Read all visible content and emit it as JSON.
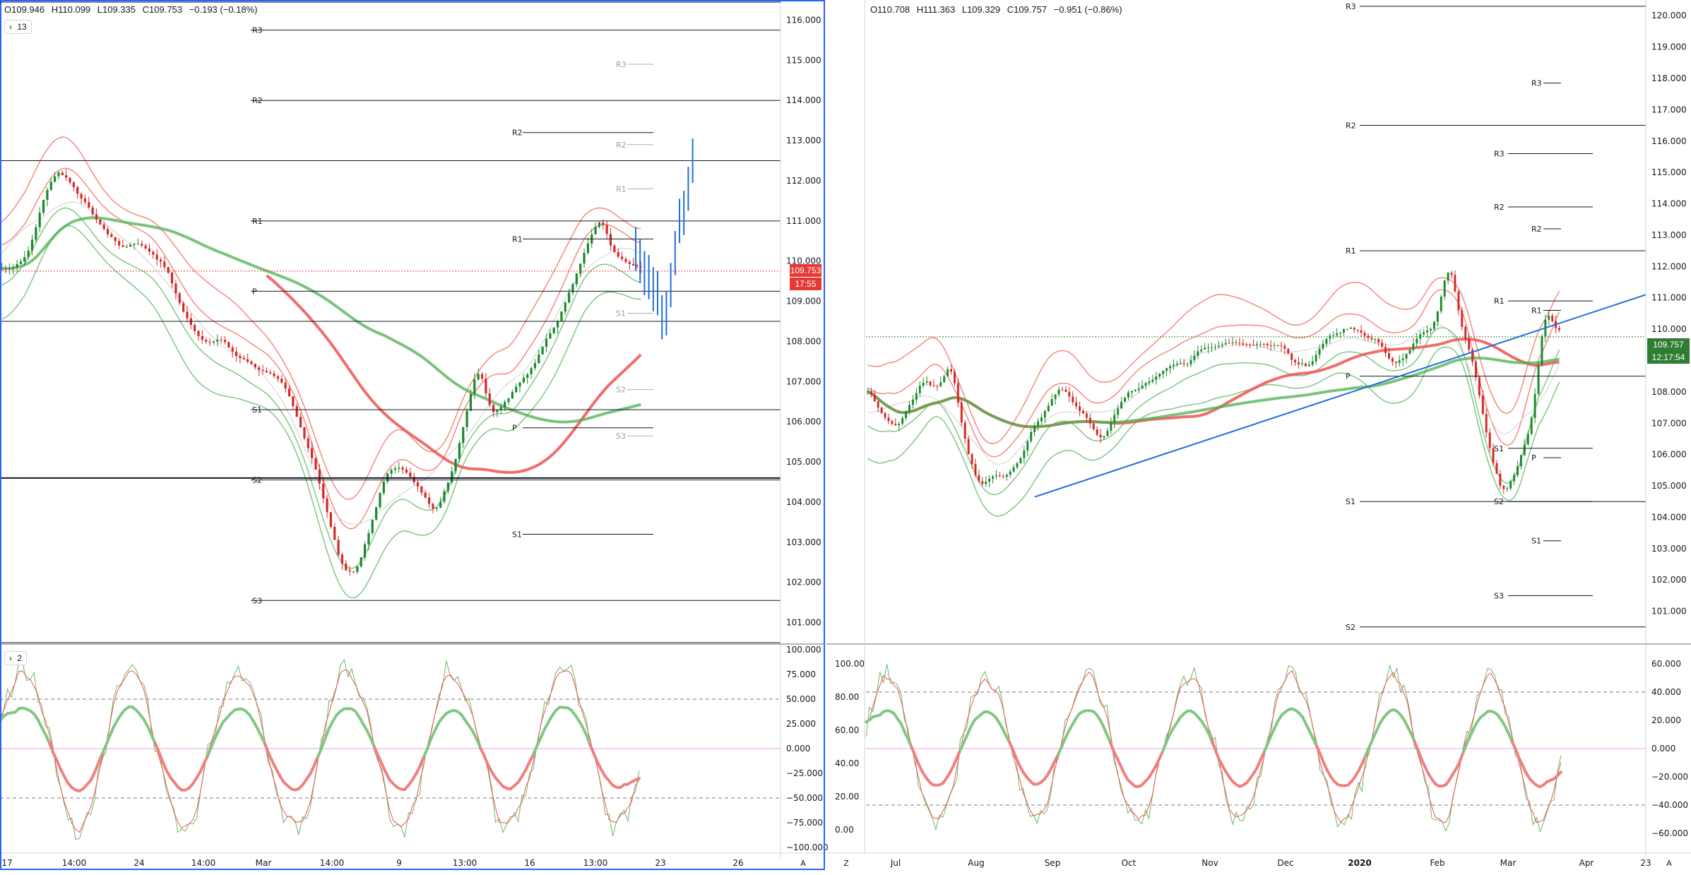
{
  "colors": {
    "accent": "#2962ff",
    "bull": "#26a69a",
    "bear": "#ef5350",
    "sma_red": "#ef5350",
    "sma_green": "#4caf50",
    "band_red": "#f28b82",
    "band_green": "#81c784",
    "grey_band": "#cfcfcf",
    "projection": "#1e6fd9",
    "price_label": "#e53935",
    "price_label_right": "#2e7d32"
  },
  "left_chart": {
    "ohlc": {
      "o": "O109.946",
      "h": "H110.099",
      "l": "L109.335",
      "c": "C109.753",
      "chg": "−0.193 (−0.18%)"
    },
    "legend_toggle": "13",
    "osc_toggle": "2",
    "price_badge": "109.753",
    "countdown_badge": "17:55",
    "pivots_major": [
      {
        "label": "R3",
        "value": 115.75
      },
      {
        "label": "R2",
        "value": 114.0
      },
      {
        "label": "R1",
        "value": 111.0
      },
      {
        "label": "P",
        "value": 109.25
      },
      {
        "label": "S1",
        "value": 106.3
      },
      {
        "label": "S2",
        "value": 104.55
      },
      {
        "label": "S3",
        "value": 101.55
      }
    ],
    "pivots_minor": [
      {
        "label": "R2",
        "value": 113.2
      },
      {
        "label": "R1",
        "value": 110.55
      },
      {
        "label": "P",
        "value": 105.85
      },
      {
        "label": "S1",
        "value": 103.2
      }
    ],
    "pivots_grey": [
      {
        "label": "R3",
        "value": 114.9
      },
      {
        "label": "R2",
        "value": 112.9
      },
      {
        "label": "R1",
        "value": 111.8
      },
      {
        "label": "S1",
        "value": 108.7
      },
      {
        "label": "S2",
        "value": 106.8
      },
      {
        "label": "S3",
        "value": 105.65
      }
    ],
    "extra_lines": [
      112.5,
      108.5,
      104.6,
      100.5
    ],
    "y_axis_ticks": [
      "116.000",
      "115.000",
      "114.000",
      "113.000",
      "112.000",
      "111.000",
      "110.000",
      "109.000",
      "108.000",
      "107.000",
      "106.000",
      "105.000",
      "104.000",
      "103.000",
      "102.000",
      "101.000"
    ],
    "osc_axis_ticks": [
      "100.000",
      "75.000",
      "50.000",
      "25.000",
      "0.000",
      "−25.000",
      "−50.000",
      "−75.000",
      "−100.000"
    ],
    "x_axis_labels": [
      "17",
      "14:00",
      "24",
      "14:00",
      "Mar",
      "14:00",
      "9",
      "13:00",
      "16",
      "13:00",
      "23",
      "26"
    ],
    "axis_corner": "A"
  },
  "right_chart": {
    "ohlc": {
      "o": "O110.708",
      "h": "H111.363",
      "l": "L109.329",
      "c": "C109.757",
      "chg": "−0.951 (−0.86%)"
    },
    "price_badge": "109.757",
    "countdown_badge": "12:17:54",
    "pivots_major": [
      {
        "label": "R3",
        "value": 120.3
      },
      {
        "label": "R2",
        "value": 116.5
      },
      {
        "label": "R1",
        "value": 112.5
      },
      {
        "label": "P",
        "value": 108.5
      },
      {
        "label": "S1",
        "value": 104.5
      },
      {
        "label": "S2",
        "value": 100.5
      }
    ],
    "pivots_mid": [
      {
        "label": "R3",
        "value": 115.6
      },
      {
        "label": "R2",
        "value": 113.9
      },
      {
        "label": "R1",
        "value": 110.9
      },
      {
        "label": "S1",
        "value": 106.2
      },
      {
        "label": "S2",
        "value": 104.5
      },
      {
        "label": "S3",
        "value": 101.5
      }
    ],
    "pivots_small": [
      {
        "label": "R3",
        "value": 117.85
      },
      {
        "label": "R2",
        "value": 113.2
      },
      {
        "label": "R1",
        "value": 110.6
      },
      {
        "label": "P",
        "value": 105.9
      },
      {
        "label": "S1",
        "value": 103.25
      }
    ],
    "y_axis_ticks": [
      "120.000",
      "119.000",
      "118.000",
      "117.000",
      "116.000",
      "115.000",
      "114.000",
      "113.000",
      "112.000",
      "111.000",
      "110.000",
      "109.000",
      "108.000",
      "107.000",
      "106.000",
      "105.000",
      "104.000",
      "103.000",
      "102.000",
      "101.000"
    ],
    "osc_left_ticks": [
      "100.00",
      "80.00",
      "60.00",
      "40.00",
      "20.00",
      "0.00"
    ],
    "osc_right_ticks": [
      "60.000",
      "40.000",
      "20.000",
      "0.000",
      "−20.000",
      "−40.000",
      "−60.000"
    ],
    "x_axis_labels": [
      "Jul",
      "Aug",
      "Sep",
      "Oct",
      "Nov",
      "Dec",
      "2020",
      "Feb",
      "Mar",
      "Apr",
      "23"
    ],
    "axis_corner_left": "Z",
    "axis_corner_right": "A"
  },
  "chart_data": [
    {
      "type": "line",
      "series": [
        {
          "values": [
            109.8,
            109.9,
            110.2,
            111.5,
            112.3,
            112.0,
            111.5,
            111.0,
            110.6,
            110.3,
            110.5,
            110.2,
            109.9,
            109.0,
            108.3,
            108.0,
            108.1,
            107.7,
            107.5,
            107.3,
            107.2,
            106.7,
            105.8,
            105.0,
            103.6,
            102.4,
            102.2,
            103.2,
            104.5,
            105.0,
            104.6,
            104.2,
            103.8,
            104.6,
            106.0,
            107.5,
            106.2,
            106.5,
            107.0,
            107.3,
            108.0,
            108.6,
            109.5,
            110.4,
            111.1,
            110.2,
            109.9,
            109.8
          ]
        }
      ],
      "ylim": [
        100.5,
        116.5
      ]
    },
    {
      "type": "line",
      "series": [
        {
          "values": [
            108.2,
            107.3,
            106.8,
            107.5,
            108.4,
            108.0,
            109.0,
            106.5,
            105.0,
            105.3,
            105.2,
            105.8,
            106.9,
            107.5,
            108.3,
            107.6,
            107.0,
            106.5,
            107.5,
            108.1,
            108.2,
            108.6,
            108.8,
            108.9,
            109.3,
            109.4,
            109.6,
            109.5,
            109.6,
            109.4,
            109.5,
            108.9,
            108.8,
            109.7,
            109.9,
            110.1,
            109.7,
            109.6,
            108.9,
            109.2,
            109.8,
            110.1,
            112.2,
            110.0,
            108.5,
            106.0,
            104.7,
            105.6,
            107.0,
            110.7,
            109.8
          ]
        }
      ],
      "ylim": [
        100.0,
        120.5
      ]
    }
  ]
}
